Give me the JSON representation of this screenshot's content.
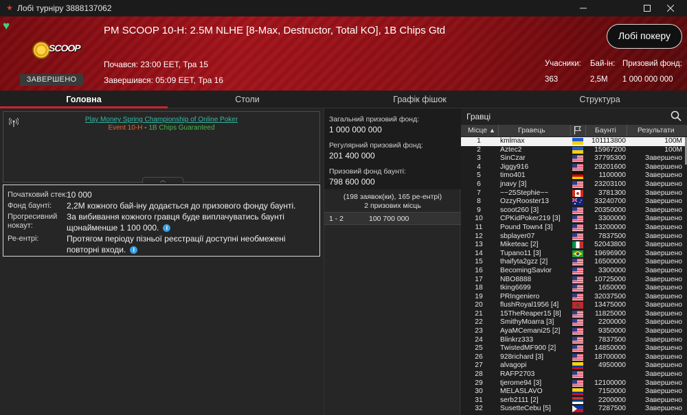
{
  "window": {
    "title": "Лобі турніру 3888137062"
  },
  "header": {
    "tournament_name": "PM SCOOP 10-H: 2.5M NLHE [8-Max, Destructor, Total KO], 1B Chips Gtd",
    "started": "Почався: 23:00 EET, Тра 15",
    "finished": "Завершився: 05:09 EET, Тра 16",
    "status_badge": "ЗАВЕРШЕНО",
    "logo_text": "SCOOP",
    "lobby_button": "Лобі покеру",
    "stats": {
      "players_label": "Учасники:",
      "players_value": "363",
      "buyin_label": "Бай-ін:",
      "buyin_value": "2,5M",
      "prize_label": "Призовий фонд:",
      "prize_value": "1 000 000 000"
    }
  },
  "tabs": [
    {
      "label": "Головна",
      "active": true
    },
    {
      "label": "Столи",
      "active": false
    },
    {
      "label": "Графік фішок",
      "active": false
    },
    {
      "label": "Структура",
      "active": false
    }
  ],
  "banner": {
    "line1": "Play Money Spring Championship of Online Poker",
    "line2_part1": "Event 10-H",
    "line2_sep": " - ",
    "line2_part2": "1B Chips Guaranteed"
  },
  "details": [
    {
      "label": "Початковий стек:",
      "value": "10 000"
    },
    {
      "label": "Фонд баунті:",
      "value": "2,2M кожного бай-іну додається до призового фонду баунті."
    },
    {
      "label": "Прогресивний нокаут:",
      "value": "За вибивання кожного гравця буде виплачуватись баунті щонайменше 1 100 000."
    },
    {
      "label": "Ре-ентрі:",
      "value": "Протягом періоду пізньої реєстрації доступні необмежені повторні входи."
    }
  ],
  "prizes": {
    "total_label": "Загальний призовий фонд:",
    "total_value": "1 000 000 000",
    "regular_label": "Регулярний призовий фонд:",
    "regular_value": "201 400 000",
    "bounty_label": "Призовий фонд баунті:",
    "bounty_value": "798 600 000",
    "entries_summary": "(198 заявок(ки), 165 ре-ентрі)",
    "paid_places": "2 призових місць",
    "payout_places": "1 - 2",
    "payout_amount": "100 700 000"
  },
  "players": {
    "search_placeholder": "Гравці",
    "columns": {
      "place": "Місце",
      "player": "Гравець",
      "bounty": "Баунті",
      "result": "Результати"
    },
    "rows": [
      {
        "place": "1",
        "name": "kmlmax",
        "flag": "ua",
        "bounty": "101113800",
        "result": "100M"
      },
      {
        "place": "2",
        "name": "Aztec2",
        "flag": "ua",
        "bounty": "15967200",
        "result": "100M"
      },
      {
        "place": "3",
        "name": "SinCzar",
        "flag": "us",
        "bounty": "37795300",
        "result": "Завершено"
      },
      {
        "place": "4",
        "name": "Jiggy916",
        "flag": "us",
        "bounty": "29201600",
        "result": "Завершено"
      },
      {
        "place": "5",
        "name": "timo401",
        "flag": "de",
        "bounty": "1100000",
        "result": "Завершено"
      },
      {
        "place": "6",
        "name": "jnavy [3]",
        "flag": "us",
        "bounty": "23203100",
        "result": "Завершено"
      },
      {
        "place": "7",
        "name": "~~25Stephie~~",
        "flag": "ca",
        "bounty": "3781300",
        "result": "Завершено"
      },
      {
        "place": "8",
        "name": "OzzyRooster13",
        "flag": "au",
        "bounty": "33240700",
        "result": "Завершено"
      },
      {
        "place": "9",
        "name": "scoot260 [3]",
        "flag": "us",
        "bounty": "20350000",
        "result": "Завершено"
      },
      {
        "place": "10",
        "name": "CPKidPoker219 [3]",
        "flag": "us",
        "bounty": "3300000",
        "result": "Завершено"
      },
      {
        "place": "11",
        "name": "Pound Town4 [3]",
        "flag": "us",
        "bounty": "13200000",
        "result": "Завершено"
      },
      {
        "place": "12",
        "name": "sbplayer07",
        "flag": "us",
        "bounty": "7837500",
        "result": "Завершено"
      },
      {
        "place": "13",
        "name": "Miketeac [2]",
        "flag": "it",
        "bounty": "52043800",
        "result": "Завершено"
      },
      {
        "place": "14",
        "name": "Tupano11 [3]",
        "flag": "br",
        "bounty": "19696900",
        "result": "Завершено"
      },
      {
        "place": "15",
        "name": "thaifyta2gzz [2]",
        "flag": "us",
        "bounty": "16500000",
        "result": "Завершено"
      },
      {
        "place": "16",
        "name": "BecomingSavior",
        "flag": "us",
        "bounty": "3300000",
        "result": "Завершено"
      },
      {
        "place": "17",
        "name": "NBO8888",
        "flag": "us",
        "bounty": "10725000",
        "result": "Завершено"
      },
      {
        "place": "18",
        "name": "tking6699",
        "flag": "us",
        "bounty": "1650000",
        "result": "Завершено"
      },
      {
        "place": "19",
        "name": "PRIngeniero",
        "flag": "us",
        "bounty": "32037500",
        "result": "Завершено"
      },
      {
        "place": "20",
        "name": "flushRoyal1956 [4]",
        "flag": "ma",
        "bounty": "13475000",
        "result": "Завершено"
      },
      {
        "place": "21",
        "name": "15TheReaper15 [8]",
        "flag": "us",
        "bounty": "11825000",
        "result": "Завершено"
      },
      {
        "place": "22",
        "name": "SmithyMoarra [3]",
        "flag": "us",
        "bounty": "2200000",
        "result": "Завершено"
      },
      {
        "place": "23",
        "name": "AyaMCemani25 [2]",
        "flag": "us",
        "bounty": "9350000",
        "result": "Завершено"
      },
      {
        "place": "24",
        "name": "Blinkrz333",
        "flag": "us",
        "bounty": "7837500",
        "result": "Завершено"
      },
      {
        "place": "25",
        "name": "TwistedMF900 [2]",
        "flag": "us",
        "bounty": "14850000",
        "result": "Завершено"
      },
      {
        "place": "26",
        "name": "928richard [3]",
        "flag": "us",
        "bounty": "18700000",
        "result": "Завершено"
      },
      {
        "place": "27",
        "name": "alvagopi",
        "flag": "co",
        "bounty": "4950000",
        "result": "Завершено"
      },
      {
        "place": "28",
        "name": "RAFP2703",
        "flag": "us",
        "bounty": "",
        "result": "Завершено"
      },
      {
        "place": "29",
        "name": "tjerome94 [3]",
        "flag": "us",
        "bounty": "12100000",
        "result": "Завершено"
      },
      {
        "place": "30",
        "name": "MELASLAVO",
        "flag": "co",
        "bounty": "7150000",
        "result": "Завершено"
      },
      {
        "place": "31",
        "name": "serb2111 [2]",
        "flag": "rs",
        "bounty": "2200000",
        "result": "Завершено"
      },
      {
        "place": "32",
        "name": "SusetteCebu [5]",
        "flag": "ph",
        "bounty": "7287500",
        "result": "Завершено"
      }
    ]
  },
  "colors": {
    "accent_red": "#d4202a",
    "banner_teal": "#34b9a4",
    "banner_orange": "#e9642c",
    "banner_green": "#47b84a",
    "heart_green": "#3fd17a",
    "info_blue": "#3aa0e0"
  }
}
